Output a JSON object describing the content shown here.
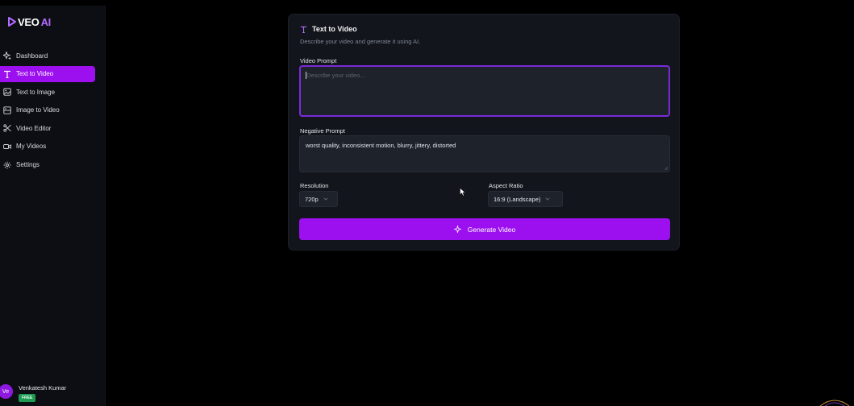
{
  "app": {
    "logo_main": "VEO",
    "logo_accent": "AI"
  },
  "sidebar": {
    "items": [
      {
        "label": "Dashboard",
        "icon": "sparkles-icon",
        "active": false
      },
      {
        "label": "Text to Video",
        "icon": "text-type-icon",
        "active": true
      },
      {
        "label": "Text to Image",
        "icon": "image-icon",
        "active": false
      },
      {
        "label": "Image to Video",
        "icon": "image-video-icon",
        "active": false
      },
      {
        "label": "Video Editor",
        "icon": "scissors-icon",
        "active": false
      },
      {
        "label": "My Videos",
        "icon": "video-camera-icon",
        "active": false
      },
      {
        "label": "Settings",
        "icon": "gear-icon",
        "active": false
      }
    ],
    "user": {
      "initials": "Ve",
      "name": "Venkatesh Kumar",
      "plan": "FREE"
    }
  },
  "card": {
    "title": "Text to Video",
    "description": "Describe your video and generate it using AI.",
    "video_prompt": {
      "label": "Video Prompt",
      "placeholder": "Describe your video...",
      "value": ""
    },
    "negative_prompt": {
      "label": "Negative Prompt",
      "value": "worst quality, inconsistent motion, blurry, jittery, distorted"
    },
    "resolution": {
      "label": "Resolution",
      "selected": "720p"
    },
    "aspect_ratio": {
      "label": "Aspect Ratio",
      "selected": "16:9 (Landscape)"
    },
    "generate_button": "Generate Video"
  },
  "colors": {
    "accent": "#9c10f0",
    "background": "#000000",
    "sidebar": "#0c0e13",
    "card": "#12151b",
    "input": "#1d222b",
    "focus_border": "#7a2bd8",
    "plan_badge": "#1d9b52"
  }
}
